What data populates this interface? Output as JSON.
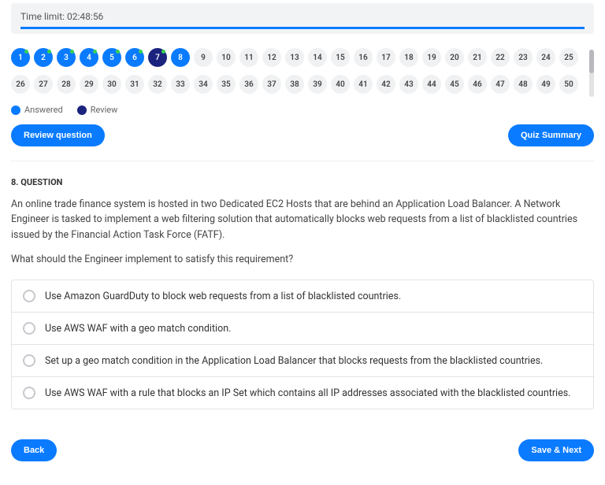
{
  "timer": {
    "label": "Time limit: 02:48:56"
  },
  "nav": {
    "total": 50,
    "current": 8,
    "answered": [
      1,
      2,
      3,
      4,
      5,
      6
    ],
    "review": [
      7
    ],
    "green_dot_on": [
      1,
      2,
      3,
      4,
      5,
      6,
      7
    ]
  },
  "legend": {
    "answered": "Answered",
    "review": "Review"
  },
  "buttons": {
    "review_question": "Review question",
    "quiz_summary": "Quiz Summary",
    "back": "Back",
    "save_next": "Save & Next"
  },
  "question": {
    "heading": "8. QUESTION",
    "body": "An online trade finance system is hosted in two Dedicated EC2 Hosts that are behind an Application Load Balancer. A Network Engineer is tasked to implement a web filtering solution that automatically blocks web requests from a list of blacklisted countries issued by the Financial Action Task Force (FATF).",
    "prompt": "What should the Engineer implement to satisfy this requirement?",
    "options": [
      "Use Amazon GuardDuty to block web requests from a list of blacklisted countries.",
      "Use AWS WAF with a geo match condition.",
      "Set up a geo match condition in the Application Load Balancer that blocks requests from the blacklisted countries.",
      "Use AWS WAF with a rule that blocks an IP Set which contains all IP addresses associated with the blacklisted countries."
    ]
  }
}
